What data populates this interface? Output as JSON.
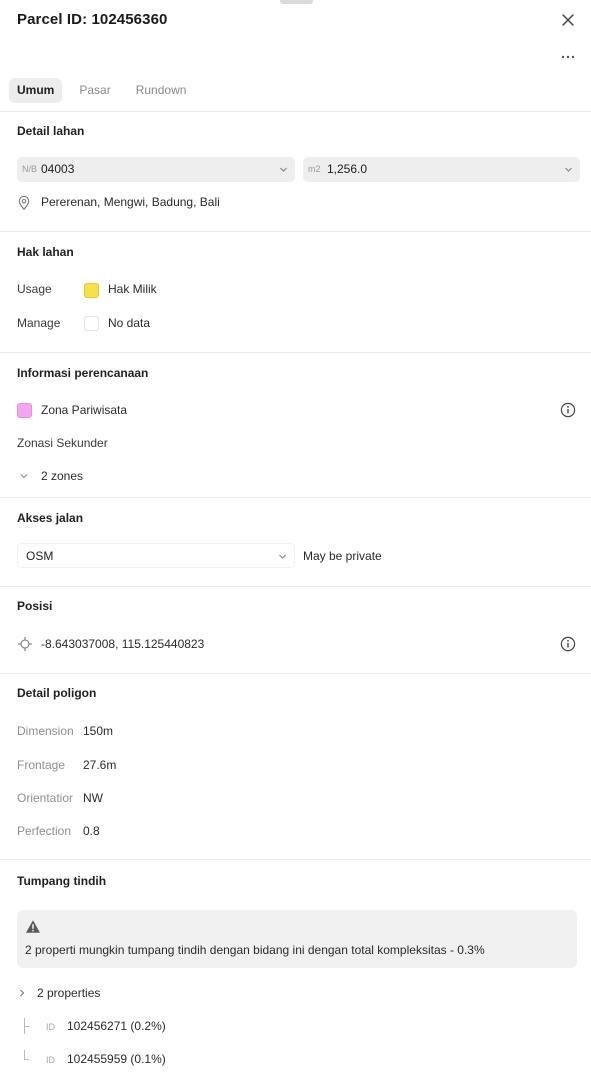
{
  "header": {
    "title": "Parcel ID: 102456360",
    "close_icon": "close-icon",
    "more_icon": "more-horizontal-icon"
  },
  "tabs": [
    {
      "label": "Umum",
      "active": true
    },
    {
      "label": "Pasar",
      "active": false
    },
    {
      "label": "Rundown",
      "active": false
    }
  ],
  "detail_lahan": {
    "title": "Detail lahan",
    "nib": {
      "prefix": "N/B",
      "value": "04003"
    },
    "area": {
      "prefix": "m2",
      "value": "1,256.0"
    },
    "location": "Pererenan, Mengwi, Badung, Bali"
  },
  "hak_lahan": {
    "title": "Hak lahan",
    "usage_label": "Usage",
    "usage_value": "Hak Milik",
    "usage_color": "#f7e14a",
    "manage_label": "Manage",
    "manage_value": "No data"
  },
  "perencanaan": {
    "title": "Informasi perencanaan",
    "zone": "Zona Pariwisata",
    "zone_color": "#f3a6ee",
    "secondary_label": "Zonasi Sekunder",
    "zones_toggle": "2 zones"
  },
  "akses_jalan": {
    "title": "Akses jalan",
    "source": "OSM",
    "status": "May be private"
  },
  "posisi": {
    "title": "Posisi",
    "coordinates": "-8.643037008, 115.125440823"
  },
  "detail_poligon": {
    "title": "Detail poligon",
    "rows": [
      {
        "label": "Dimension",
        "value": "150m"
      },
      {
        "label": "Frontage",
        "value": "27.6m"
      },
      {
        "label": "Orientatior",
        "value": "NW"
      },
      {
        "label": "Perfection",
        "value": "0.8"
      }
    ]
  },
  "tumpang_tindih": {
    "title": "Tumpang tindih",
    "warning": "2 properti mungkin tumpang tindih dengan bidang ini dengan total kompleksitas - 0.3%",
    "properties_toggle": "2 properties",
    "id_tag": "ID",
    "items": [
      {
        "value": "102456271 (0.2%)"
      },
      {
        "value": "102455959 (0.1%)"
      }
    ]
  }
}
